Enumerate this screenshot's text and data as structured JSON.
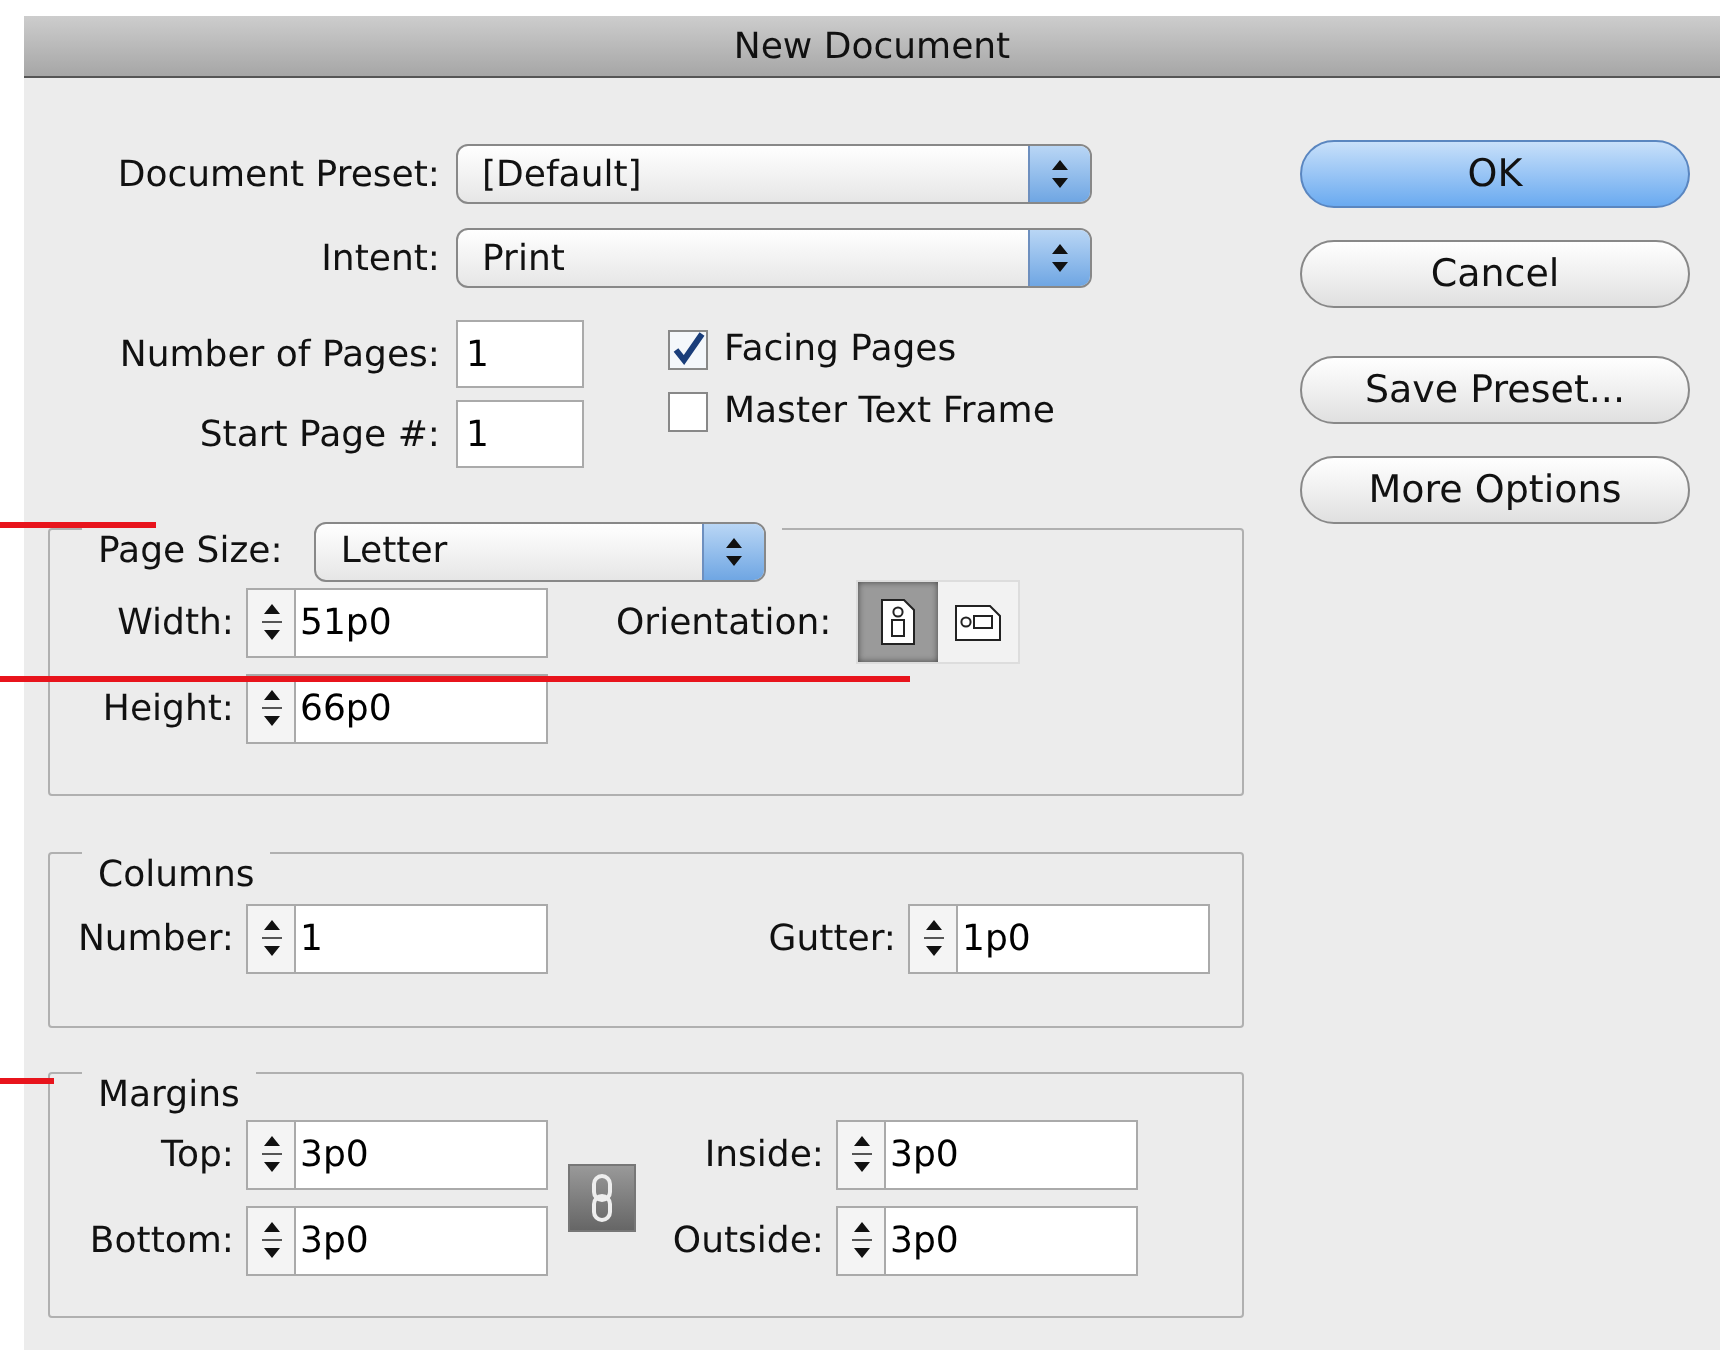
{
  "window": {
    "title": "New Document"
  },
  "document_preset": {
    "label": "Document Preset:",
    "value": "[Default]"
  },
  "intent": {
    "label": "Intent:",
    "value": "Print"
  },
  "number_of_pages": {
    "label": "Number of Pages:",
    "value": "1"
  },
  "start_page": {
    "label": "Start Page #:",
    "value": "1"
  },
  "options": [
    {
      "label": "Facing Pages",
      "checked": true
    },
    {
      "label": "Master Text Frame",
      "checked": false
    }
  ],
  "page_size": {
    "label": "Page Size:",
    "value": "Letter",
    "fields": [
      {
        "label": "Width:",
        "value": "51p0"
      },
      {
        "label": "Height:",
        "value": "66p0"
      }
    ],
    "orientation": {
      "label": "Orientation:",
      "options": [
        {
          "kind": "portrait",
          "selected": true
        },
        {
          "kind": "landscape",
          "selected": false
        }
      ]
    }
  },
  "columns": {
    "title": "Columns",
    "fields": [
      {
        "label": "Number:",
        "value": "1"
      },
      {
        "label": "Gutter:",
        "value": "1p0"
      }
    ]
  },
  "margins": {
    "title": "Margins",
    "linked": true,
    "fields": [
      {
        "label": "Top:",
        "value": "3p0"
      },
      {
        "label": "Inside:",
        "value": "3p0"
      },
      {
        "label": "Bottom:",
        "value": "3p0"
      },
      {
        "label": "Outside:",
        "value": "3p0"
      }
    ]
  },
  "buttons": [
    {
      "label": "OK",
      "default": true
    },
    {
      "label": "Cancel",
      "default": false
    },
    {
      "label": "Save Preset...",
      "default": false
    },
    {
      "label": "More Options",
      "default": false
    }
  ]
}
